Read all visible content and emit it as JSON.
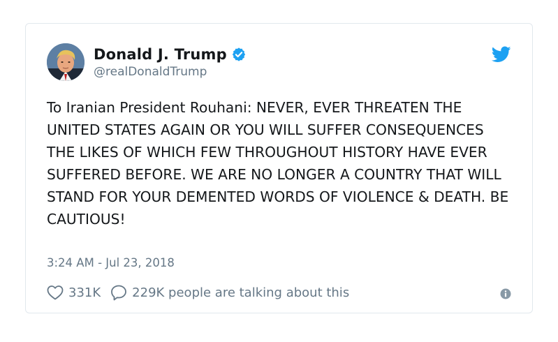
{
  "tweet": {
    "display_name": "Donald J. Trump",
    "handle": "@realDonaldTrump",
    "text": "To Iranian President Rouhani: NEVER, EVER THREATEN THE UNITED STATES AGAIN OR YOU WILL SUFFER CONSEQUENCES THE LIKES OF WHICH FEW THROUGHOUT HISTORY HAVE EVER SUFFERED BEFORE. WE ARE NO LONGER A COUNTRY THAT WILL STAND FOR YOUR DEMENTED WORDS OF VIOLENCE & DEATH. BE CAUTIOUS!",
    "timestamp": "3:24 AM - Jul 23, 2018",
    "likes": "331K",
    "talking": "229K people are talking about this"
  },
  "icons": {
    "avatar": "avatar-photo",
    "verified": "verified-badge-icon",
    "brand": "twitter-bird-icon",
    "like": "heart-icon",
    "reply": "speech-bubble-icon",
    "info": "info-icon"
  },
  "colors": {
    "brand_blue": "#1da1f2",
    "text_primary": "#14171a",
    "text_secondary": "#657786",
    "border": "#e1e8ed",
    "info_gray": "#8899a6"
  }
}
